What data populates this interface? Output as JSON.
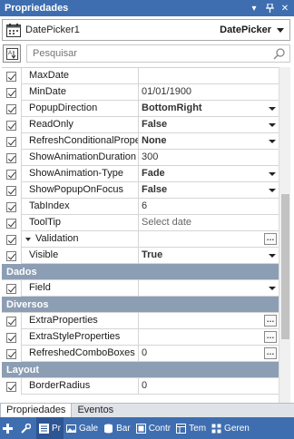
{
  "window": {
    "title": "Propriedades"
  },
  "selector": {
    "name": "DatePicker1",
    "type": "DatePicker"
  },
  "search": {
    "placeholder": "Pesquisar"
  },
  "rows_top": [
    {
      "name": "MaxDate",
      "value": ""
    },
    {
      "name": "MinDate",
      "value": "01/01/1900"
    },
    {
      "name": "PopupDirection",
      "value": "BottomRight"
    },
    {
      "name": "ReadOnly",
      "value": "False"
    },
    {
      "name": "RefreshConditionalProperties",
      "value": "None"
    },
    {
      "name": "ShowAnimationDuration",
      "value": "300"
    },
    {
      "name": "ShowAnimation-Type",
      "value": "Fade"
    },
    {
      "name": "ShowPopupOnFocus",
      "value": "False"
    },
    {
      "name": "TabIndex",
      "value": "6"
    },
    {
      "name": "ToolTip",
      "value": "Select date"
    },
    {
      "name": "Validation",
      "value": ""
    },
    {
      "name": "Visible",
      "value": "True"
    }
  ],
  "categories": {
    "dados": "Dados",
    "diversos": "Diversos",
    "layout": "Layout"
  },
  "rows_dados": [
    {
      "name": "Field",
      "value": ""
    }
  ],
  "rows_diversos": [
    {
      "name": "ExtraProperties",
      "value": ""
    },
    {
      "name": "ExtraStyleProperties",
      "value": ""
    },
    {
      "name": "RefreshedComboBoxes",
      "value": "0"
    }
  ],
  "rows_layout": [
    {
      "name": "BorderRadius",
      "value": "0"
    }
  ],
  "tabs": {
    "properties": "Propriedades",
    "events": "Eventos"
  },
  "toolbar": {
    "items": [
      "Pr",
      "Gale",
      "Bar",
      "Contr",
      "Tem",
      "Geren"
    ]
  },
  "colors": {
    "titlebar": "#3f6eb0",
    "category": "#8c9eb4"
  }
}
